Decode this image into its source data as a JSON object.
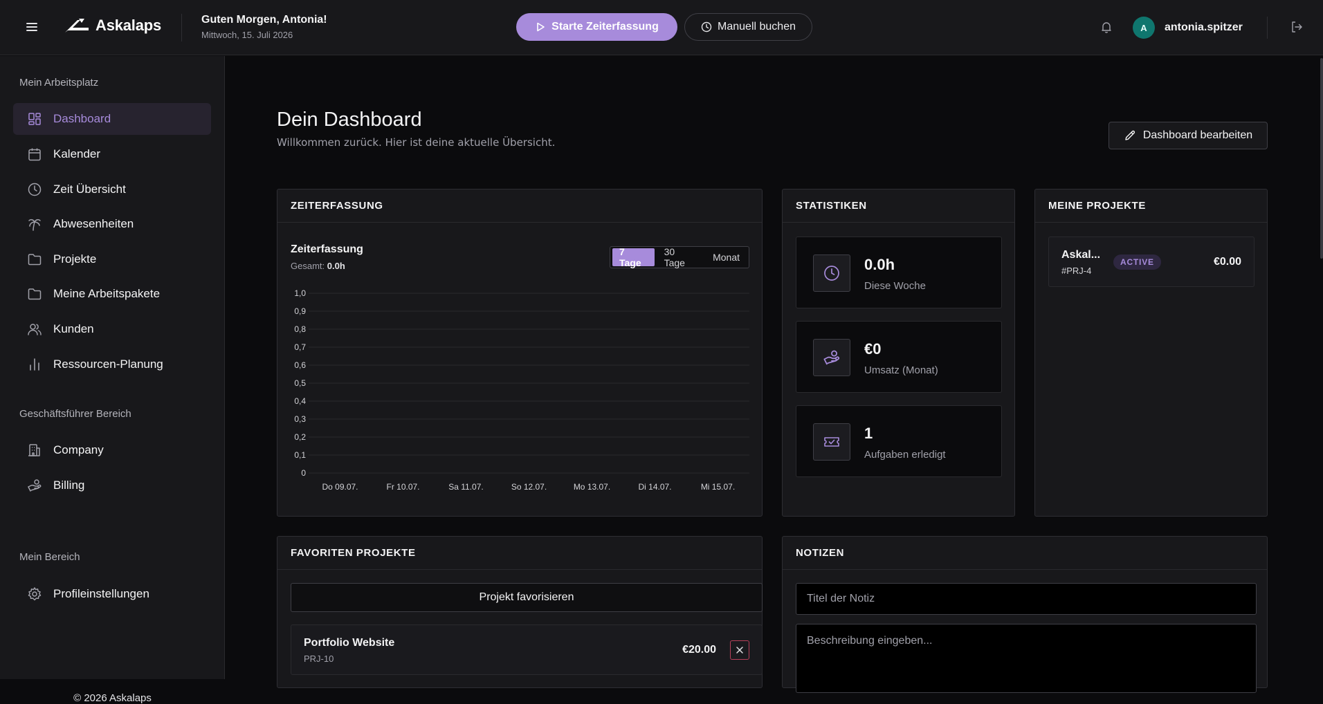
{
  "app": {
    "name": "Askalaps"
  },
  "header": {
    "greeting": "Guten Morgen, Antonia!",
    "date": "Mittwoch, 15. Juli 2026",
    "start_label": "Starte Zeiterfassung",
    "manual_label": "Manuell buchen",
    "avatar_initial": "A",
    "username": "antonia.spitzer"
  },
  "sidebar": {
    "sections": [
      {
        "title": "Mein Arbeitsplatz"
      },
      {
        "title": "Geschäftsführer Bereich"
      },
      {
        "title": "Mein Bereich"
      }
    ],
    "items": [
      {
        "label": "Dashboard",
        "icon": "dashboard-icon",
        "active": true
      },
      {
        "label": "Kalender",
        "icon": "calendar-icon"
      },
      {
        "label": "Zeit Übersicht",
        "icon": "clock-icon"
      },
      {
        "label": "Abwesenheiten",
        "icon": "palm-tree-icon"
      },
      {
        "label": "Projekte",
        "icon": "folder-icon"
      },
      {
        "label": "Meine Arbeitspakete",
        "icon": "folder-icon"
      },
      {
        "label": "Kunden",
        "icon": "users-icon"
      },
      {
        "label": "Ressourcen-Planung",
        "icon": "bar-chart-icon"
      },
      {
        "label": "Company",
        "icon": "building-icon"
      },
      {
        "label": "Billing",
        "icon": "hand-coins-icon"
      },
      {
        "label": "Profileinstellungen",
        "icon": "gear-icon"
      }
    ],
    "copyright": "© 2026 Askalaps"
  },
  "main": {
    "title": "Dein Dashboard",
    "subtitle": "Willkommen zurück. Hier ist deine aktuelle Übersicht.",
    "edit_label": "Dashboard bearbeiten"
  },
  "zeiterfassung": {
    "heading": "ZEITERFASSUNG",
    "chart_title": "Zeiterfassung",
    "total_label": "Gesamt:",
    "total_value": "0.0h",
    "ranges": [
      "7 Tage",
      "30 Tage",
      "Monat"
    ],
    "active_range": "7 Tage"
  },
  "chart_data": {
    "type": "bar",
    "title": "Zeiterfassung",
    "categories": [
      "Do 09.07.",
      "Fr 10.07.",
      "Sa 11.07.",
      "So 12.07.",
      "Mo 13.07.",
      "Di 14.07.",
      "Mi 15.07."
    ],
    "values": [
      0,
      0,
      0,
      0,
      0,
      0,
      0
    ],
    "ylim": [
      0,
      1
    ],
    "yticks": [
      "0",
      "0,1",
      "0,2",
      "0,3",
      "0,4",
      "0,5",
      "0,6",
      "0,7",
      "0,8",
      "0,9",
      "1,0"
    ],
    "grid": true,
    "xlabel": "",
    "ylabel": ""
  },
  "statistiken": {
    "heading": "STATISTIKEN",
    "items": [
      {
        "value": "0.0h",
        "label": "Diese Woche",
        "icon": "clock-icon"
      },
      {
        "value": "€0",
        "label": "Umsatz (Monat)",
        "icon": "hand-coins-icon"
      },
      {
        "value": "1",
        "label": "Aufgaben erledigt",
        "icon": "ticket-check-icon"
      }
    ]
  },
  "projekte": {
    "heading": "MEINE PROJEKTE",
    "items": [
      {
        "name": "Askal...",
        "code": "#PRJ-4",
        "status": "ACTIVE",
        "amount": "€0.00"
      }
    ]
  },
  "favoriten": {
    "heading": "FAVORITEN PROJEKTE",
    "add_label": "Projekt favorisieren",
    "items": [
      {
        "name": "Portfolio Website",
        "code": "PRJ-10",
        "amount": "€20.00"
      }
    ]
  },
  "notizen": {
    "heading": "NOTIZEN",
    "title_placeholder": "Titel der Notiz",
    "desc_placeholder": "Beschreibung eingeben..."
  },
  "colors": {
    "accent": "#a78bdb",
    "background": "#0b0b0d",
    "panel": "#18181b",
    "avatar": "#0f766e"
  }
}
